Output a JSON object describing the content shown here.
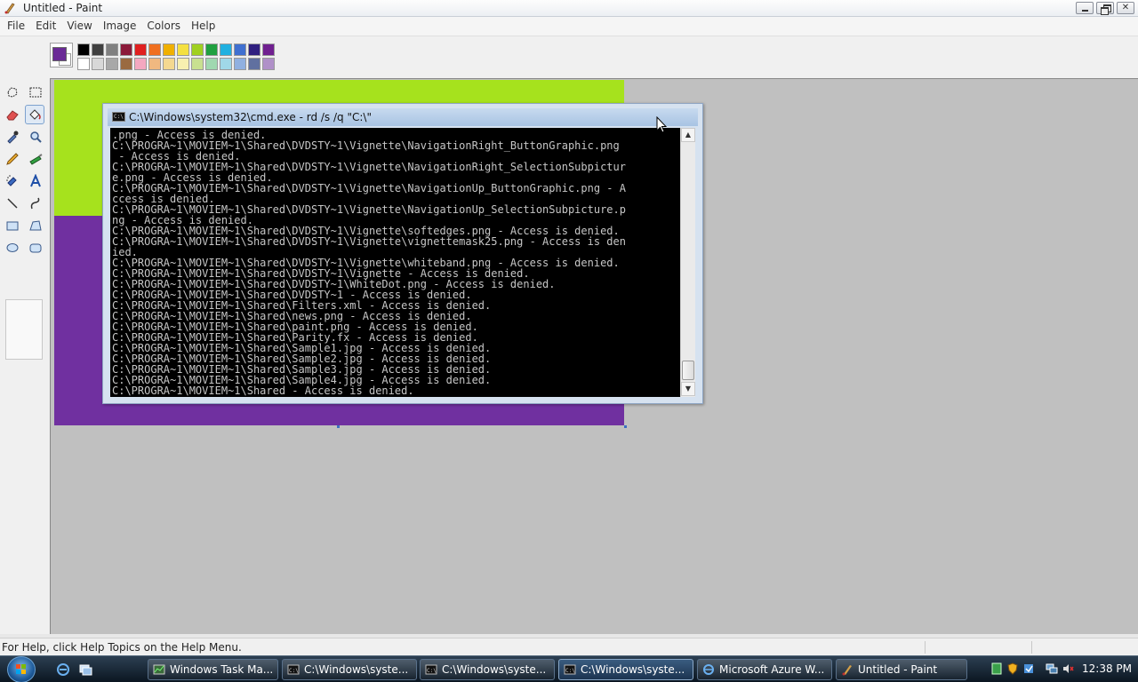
{
  "window": {
    "title": "Untitled - Paint",
    "close_glyph": "✕"
  },
  "menu": [
    "File",
    "Edit",
    "View",
    "Image",
    "Colors",
    "Help"
  ],
  "colors": {
    "foreground": "#6a2a96",
    "background": "#ffffff",
    "palette_top": [
      "#000000",
      "#404040",
      "#808080",
      "#8b1a3a",
      "#e02020",
      "#f07020",
      "#f0b000",
      "#f4e040",
      "#a0d020",
      "#20a040",
      "#20b0e0",
      "#4070d0",
      "#302080",
      "#702090"
    ],
    "palette_bottom": [
      "#ffffff",
      "#d8d8d8",
      "#a8a8a8",
      "#9a6a40",
      "#f4a8c0",
      "#f0b880",
      "#f4d890",
      "#f8f0b0",
      "#c8e090",
      "#a0d8b0",
      "#a0d8e8",
      "#90b0e0",
      "#6070a0",
      "#b090c8"
    ]
  },
  "tools": [
    "free-select-tool",
    "rect-select-tool",
    "eraser-tool",
    "fill-tool",
    "color-picker-tool",
    "magnifier-tool",
    "pencil-tool",
    "brush-tool",
    "airbrush-tool",
    "text-tool",
    "line-tool",
    "curve-tool",
    "rectangle-tool",
    "polygon-tool",
    "ellipse-tool",
    "rounded-rect-tool"
  ],
  "canvas": {
    "top_color": "#a6e21d",
    "bottom_color": "#7030a0"
  },
  "status": {
    "help_text": "For Help, click Help Topics on the Help Menu."
  },
  "cmd": {
    "title": "C:\\Windows\\system32\\cmd.exe - rd  /s /q \"C:\\\"",
    "icon_text": "C:\\",
    "lines": [
      ".png - Access is denied.",
      "C:\\PROGRA~1\\MOVIEM~1\\Shared\\DVDSTY~1\\Vignette\\NavigationRight_ButtonGraphic.png",
      " - Access is denied.",
      "C:\\PROGRA~1\\MOVIEM~1\\Shared\\DVDSTY~1\\Vignette\\NavigationRight_SelectionSubpictur",
      "e.png - Access is denied.",
      "C:\\PROGRA~1\\MOVIEM~1\\Shared\\DVDSTY~1\\Vignette\\NavigationUp_ButtonGraphic.png - A",
      "ccess is denied.",
      "C:\\PROGRA~1\\MOVIEM~1\\Shared\\DVDSTY~1\\Vignette\\NavigationUp_SelectionSubpicture.p",
      "ng - Access is denied.",
      "C:\\PROGRA~1\\MOVIEM~1\\Shared\\DVDSTY~1\\Vignette\\softedges.png - Access is denied.",
      "C:\\PROGRA~1\\MOVIEM~1\\Shared\\DVDSTY~1\\Vignette\\vignettemask25.png - Access is den",
      "ied.",
      "C:\\PROGRA~1\\MOVIEM~1\\Shared\\DVDSTY~1\\Vignette\\whiteband.png - Access is denied.",
      "C:\\PROGRA~1\\MOVIEM~1\\Shared\\DVDSTY~1\\Vignette - Access is denied.",
      "C:\\PROGRA~1\\MOVIEM~1\\Shared\\DVDSTY~1\\WhiteDot.png - Access is denied.",
      "C:\\PROGRA~1\\MOVIEM~1\\Shared\\DVDSTY~1 - Access is denied.",
      "C:\\PROGRA~1\\MOVIEM~1\\Shared\\Filters.xml - Access is denied.",
      "C:\\PROGRA~1\\MOVIEM~1\\Shared\\news.png - Access is denied.",
      "C:\\PROGRA~1\\MOVIEM~1\\Shared\\paint.png - Access is denied.",
      "C:\\PROGRA~1\\MOVIEM~1\\Shared\\Parity.fx - Access is denied.",
      "C:\\PROGRA~1\\MOVIEM~1\\Shared\\Sample1.jpg - Access is denied.",
      "C:\\PROGRA~1\\MOVIEM~1\\Shared\\Sample2.jpg - Access is denied.",
      "C:\\PROGRA~1\\MOVIEM~1\\Shared\\Sample3.jpg - Access is denied.",
      "C:\\PROGRA~1\\MOVIEM~1\\Shared\\Sample4.jpg - Access is denied.",
      "C:\\PROGRA~1\\MOVIEM~1\\Shared - Access is denied."
    ]
  },
  "taskbar": {
    "buttons": [
      {
        "label": "Windows Task Ma...",
        "icon": "task-manager-icon",
        "active": false
      },
      {
        "label": "C:\\Windows\\syste...",
        "icon": "cmd-icon",
        "active": false
      },
      {
        "label": "C:\\Windows\\syste...",
        "icon": "cmd-icon",
        "active": false
      },
      {
        "label": "C:\\Windows\\syste...",
        "icon": "cmd-icon",
        "active": true
      },
      {
        "label": "Microsoft Azure W...",
        "icon": "ie-icon",
        "active": false
      },
      {
        "label": "Untitled - Paint",
        "icon": "paint-icon",
        "active": false
      }
    ],
    "clock": "12:38 PM"
  }
}
